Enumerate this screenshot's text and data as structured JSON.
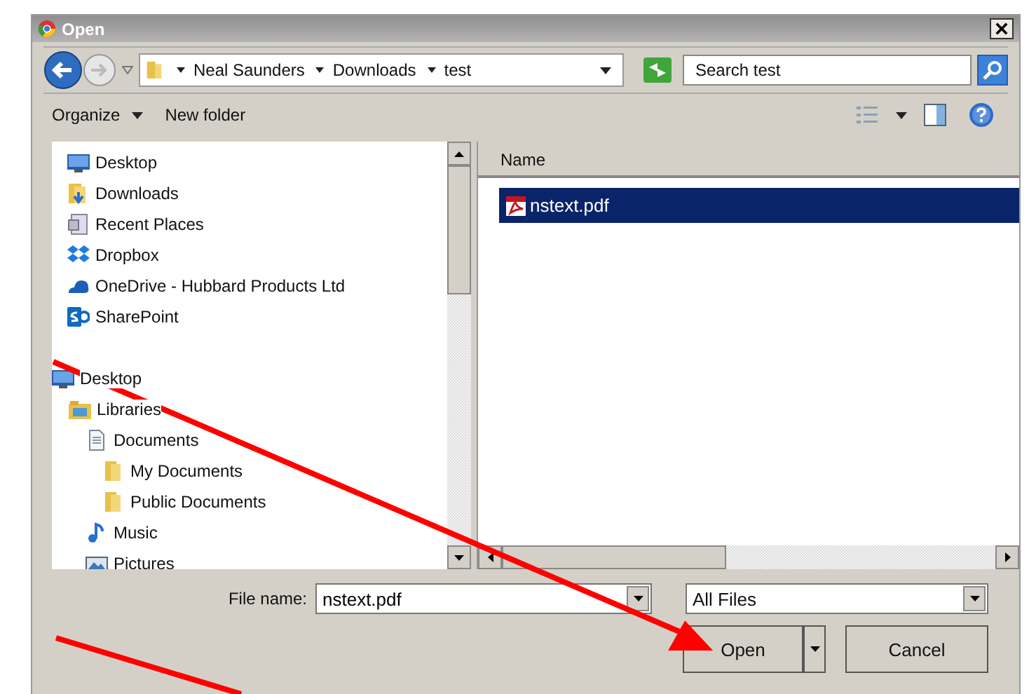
{
  "window": {
    "title": "Open"
  },
  "address_bar": {
    "breadcrumbs": [
      "Neal Saunders",
      "Downloads",
      "test"
    ]
  },
  "search": {
    "placeholder": "Search test"
  },
  "toolbar": {
    "buttons": [
      {
        "label": "Organize",
        "kind": "menu"
      },
      {
        "label": "New folder",
        "kind": "plain"
      }
    ]
  },
  "nav_pane": {
    "favorites": [
      {
        "label": "Desktop",
        "kind": "desktop"
      },
      {
        "label": "Downloads",
        "kind": "downloads"
      },
      {
        "label": "Recent Places",
        "kind": "recent"
      },
      {
        "label": "Dropbox",
        "kind": "dropbox"
      },
      {
        "label": "OneDrive - Hubbard Products Ltd",
        "kind": "cloud"
      },
      {
        "label": "SharePoint",
        "kind": "sharepoint"
      }
    ],
    "tree": [
      {
        "label": "Desktop",
        "kind": "desktop",
        "children": [
          {
            "label": "Libraries",
            "kind": "libraries",
            "children": [
              {
                "label": "Documents",
                "kind": "documents",
                "children": [
                  {
                    "label": "My Documents",
                    "kind": "folder"
                  },
                  {
                    "label": "Public Documents",
                    "kind": "folder"
                  }
                ]
              },
              {
                "label": "Music",
                "kind": "music"
              },
              {
                "label": "Pictures",
                "kind": "pictures"
              }
            ]
          }
        ]
      }
    ]
  },
  "file_list": {
    "columns": [
      "Name"
    ],
    "rows": [
      {
        "name": "nstext.pdf",
        "selected": true
      }
    ]
  },
  "file_name": {
    "label": "File name:",
    "value": "nstext.pdf"
  },
  "file_type": {
    "value": "All Files"
  },
  "buttons": [
    {
      "label": "Open",
      "kind": "split"
    },
    {
      "label": "Cancel",
      "kind": "plain"
    }
  ]
}
